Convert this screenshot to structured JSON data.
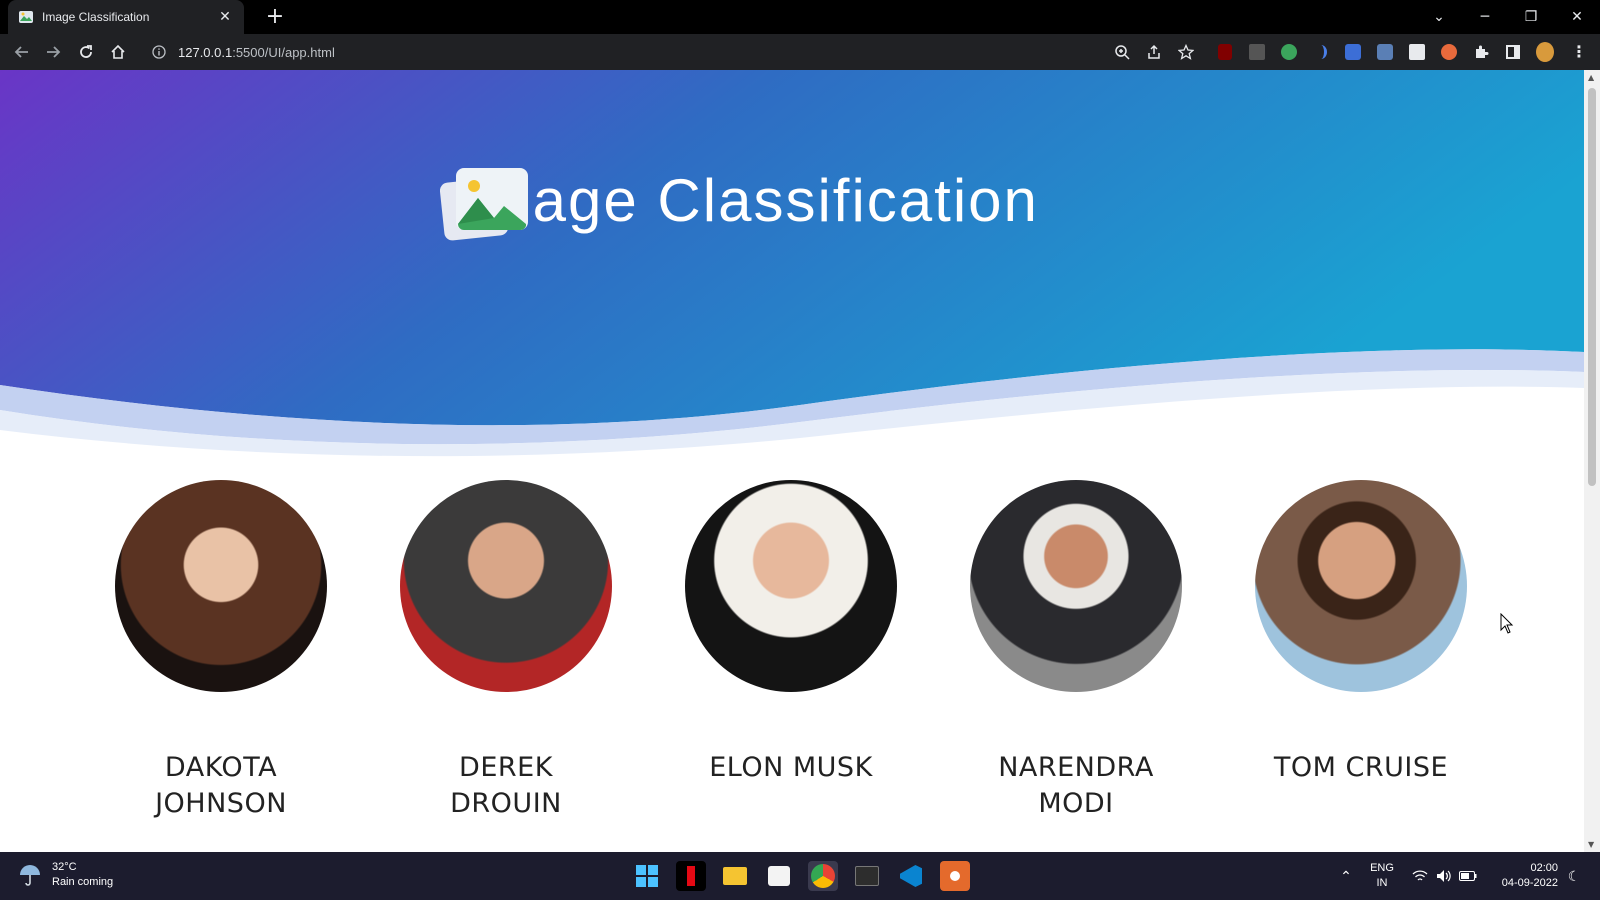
{
  "browser": {
    "tab_title": "Image Classification",
    "url_host": "127.0.0.1",
    "url_rest": ":5500/UI/app.html"
  },
  "page": {
    "title": "Image Classification",
    "gradient_start": "#6a35c6",
    "gradient_end": "#1aa3d2",
    "people": [
      {
        "name_line1": "DAKOTA",
        "name_line2": "JOHNSON",
        "avatar_color": "#4a2a1e"
      },
      {
        "name_line1": "DEREK",
        "name_line2": "DROUIN",
        "avatar_color": "#6b4d3a"
      },
      {
        "name_line1": "ELON MUSK",
        "name_line2": "",
        "avatar_color": "#2a2a2a"
      },
      {
        "name_line1": "NARENDRA",
        "name_line2": "MODI",
        "avatar_color": "#8c8c8c"
      },
      {
        "name_line1": "TOM CRUISE",
        "name_line2": "",
        "avatar_color": "#7aa7c7"
      }
    ]
  },
  "taskbar": {
    "weather_temp": "32°C",
    "weather_desc": "Rain coming",
    "lang_top": "ENG",
    "lang_bottom": "IN",
    "time": "02:00",
    "date": "04-09-2022"
  }
}
